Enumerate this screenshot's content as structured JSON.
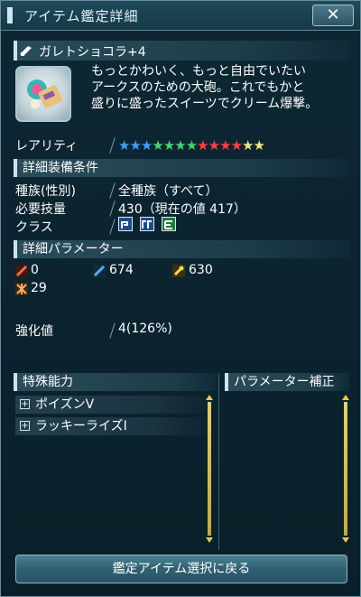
{
  "window": {
    "title": "アイテム鑑定詳細",
    "close_label": "✕"
  },
  "weapon": {
    "name": "ガレトショコラ+4",
    "description": "もっとかわいく、もっと自由でいたい\nアークスのための大砲。これでもかと\n盛りに盛ったスイーツでクリーム爆撃。"
  },
  "rarity": {
    "label": "レアリティ",
    "stars": 13,
    "colors": [
      "#3aa0ff",
      "#3aa0ff",
      "#3aa0ff",
      "#48d26a",
      "#48d26a",
      "#48d26a",
      "#48d26a",
      "#ff4040",
      "#ff4040",
      "#ff4040",
      "#ff4040",
      "#f2e480",
      "#f2e480"
    ]
  },
  "requirements": {
    "header": "詳細装備条件",
    "race_label": "種族(性別)",
    "race_value": "全種族（すべて）",
    "skill_label": "必要技量",
    "skill_value": "430（現在の値 417）",
    "class_label": "クラス",
    "class_icons": [
      "ranger-class-icon",
      "gunner-class-icon",
      "braver-class-icon"
    ]
  },
  "parameters": {
    "header": "詳細パラメーター",
    "attack": "0",
    "ranged": "674",
    "tech": "630",
    "dexterity": "29"
  },
  "enhance": {
    "label": "強化値",
    "value": "4(126%)"
  },
  "abilities": {
    "header": "特殊能力",
    "items": [
      "ポイズンV",
      "ラッキーライズI"
    ]
  },
  "param_bonus": {
    "header": "パラメーター補正"
  },
  "actions": {
    "back_label": "鑑定アイテム選択に戻る"
  }
}
